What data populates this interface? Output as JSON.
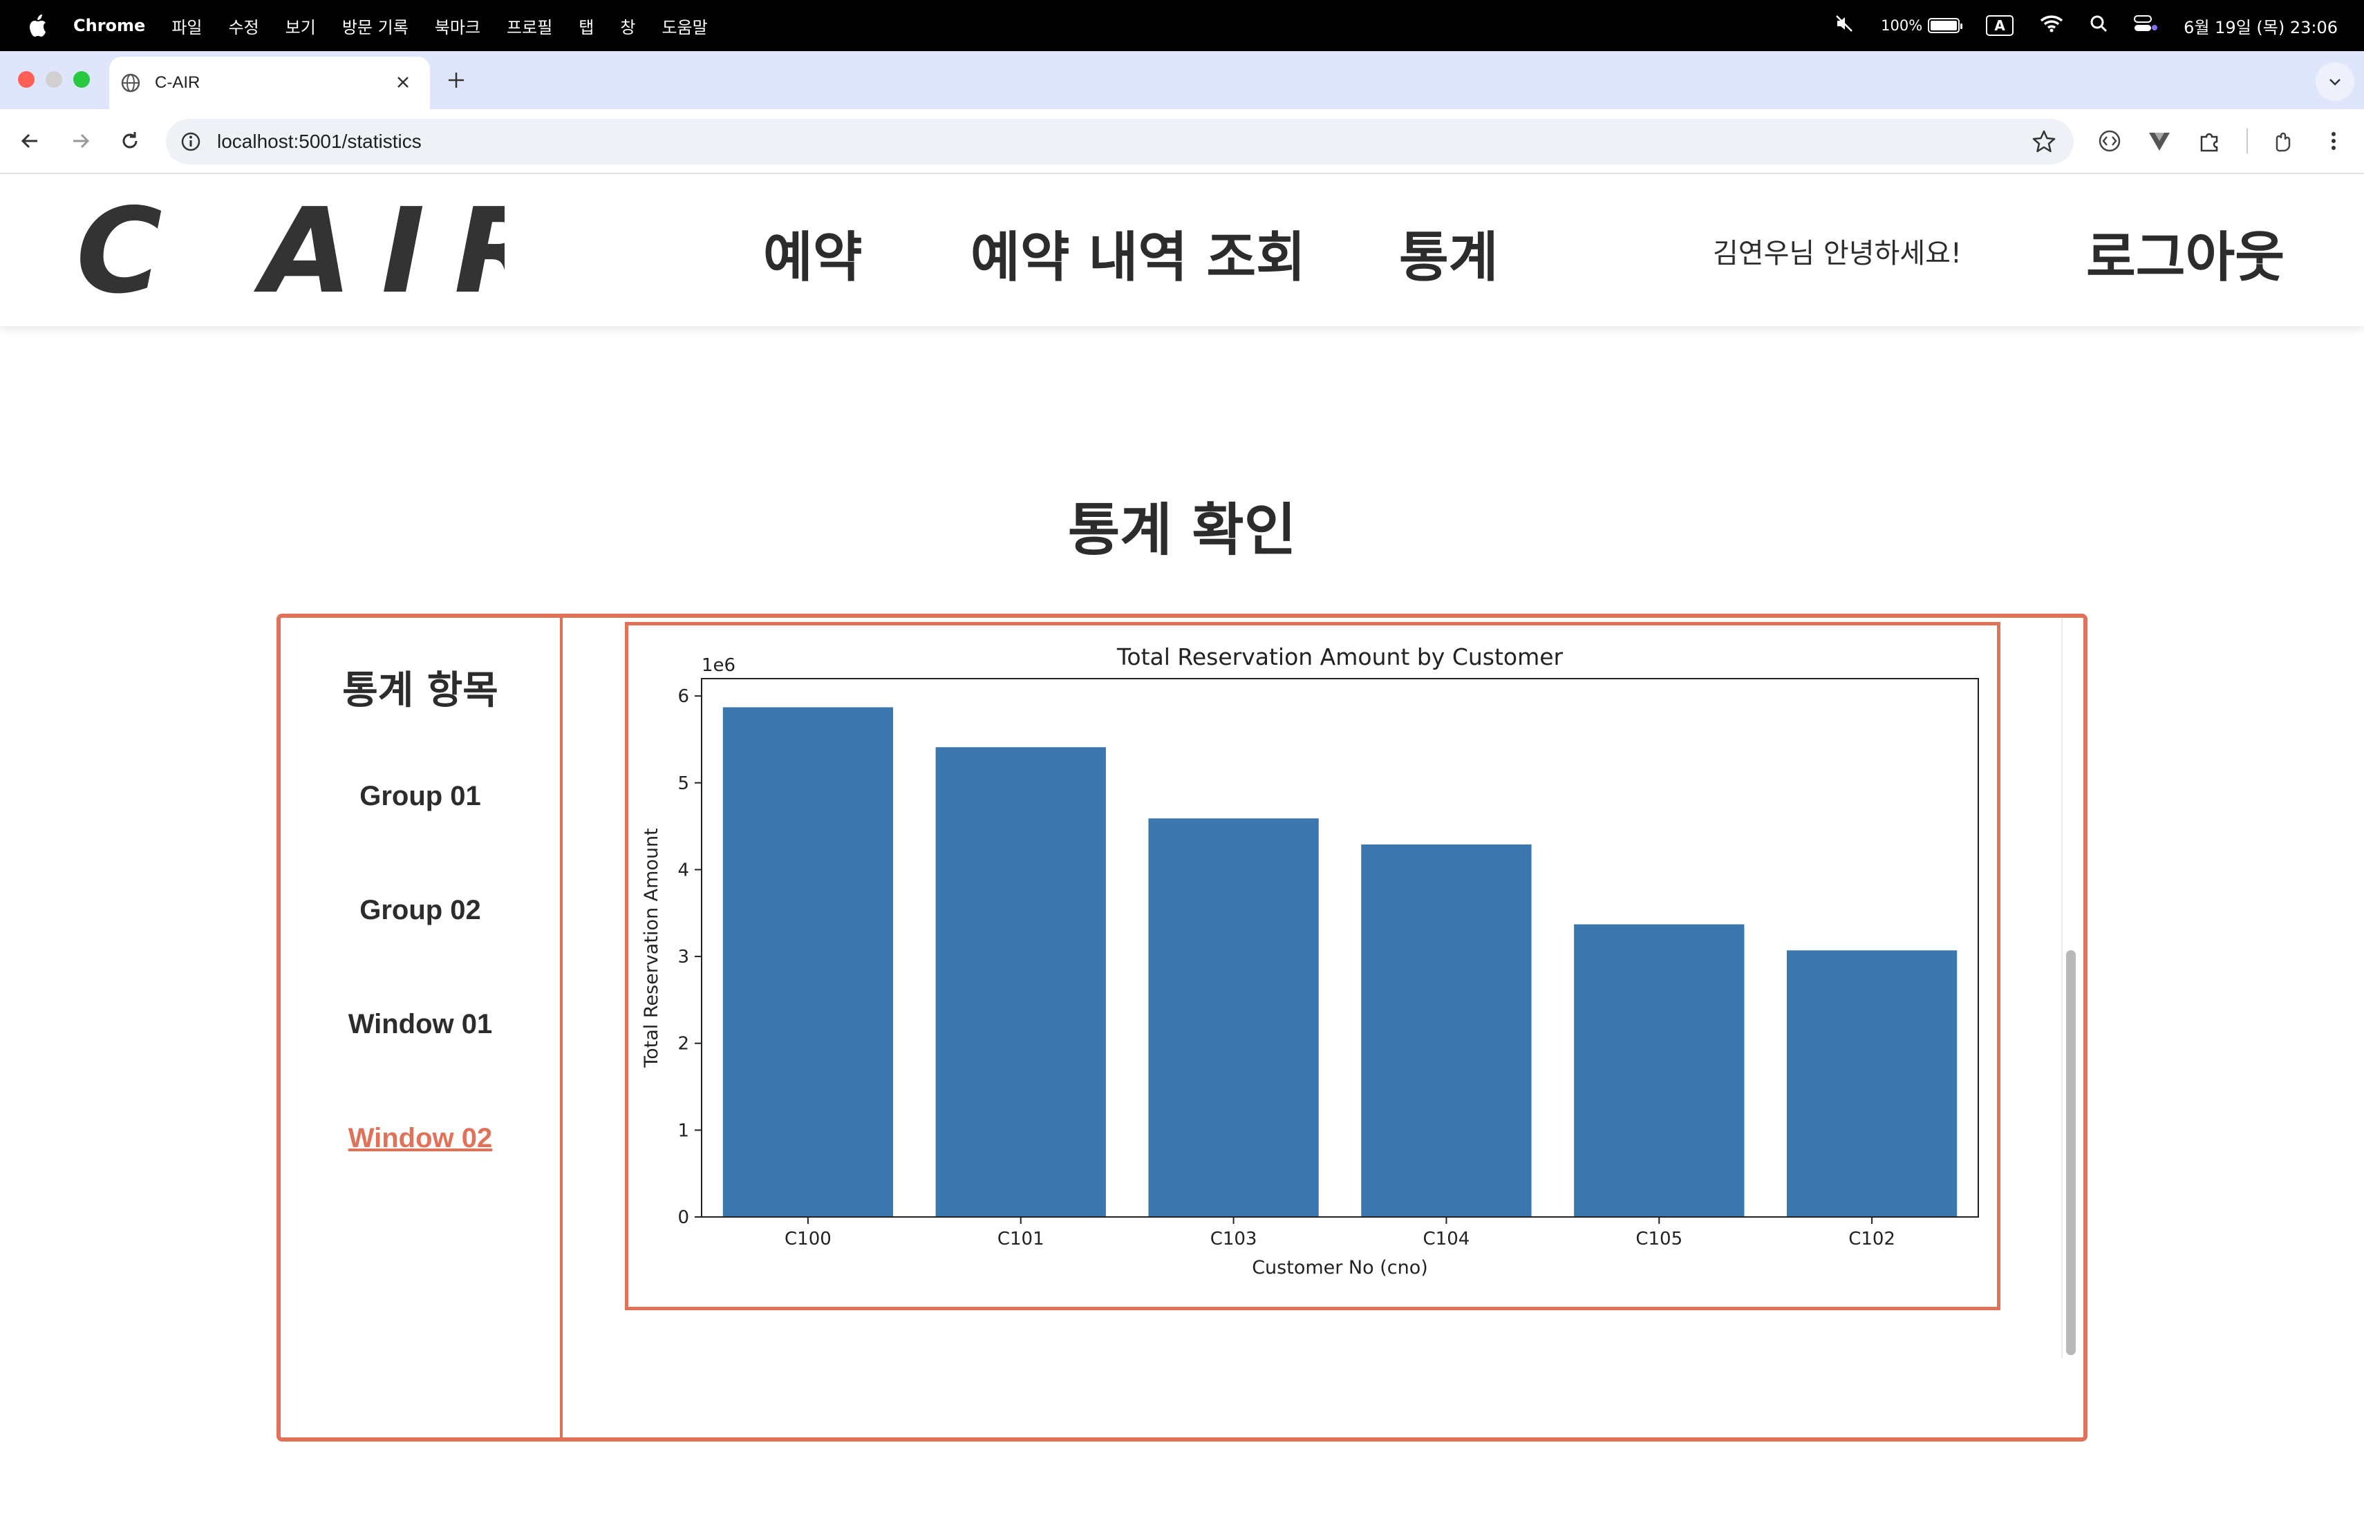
{
  "menubar": {
    "items": [
      "Chrome",
      "파일",
      "수정",
      "보기",
      "방문 기록",
      "북마크",
      "프로필",
      "탭",
      "창",
      "도움말"
    ],
    "battery": "100%",
    "battery_level_percent": 100,
    "input_source": "A",
    "datetime": "6월 19일 (목) 23:06"
  },
  "browser": {
    "tab_title": "C-AIR",
    "url": "localhost:5001/statistics"
  },
  "site": {
    "logo_text": "C AIR",
    "nav": [
      "예약",
      "예약 내역 조회",
      "통계"
    ],
    "greeting": "김연우님 안녕하세요!",
    "logout": "로그아웃"
  },
  "page": {
    "title": "통계 확인",
    "menu_heading": "통계 항목",
    "menu_items": [
      "Group 01",
      "Group 02",
      "Window 01",
      "Window 02"
    ],
    "active_item": "Window 02"
  },
  "colors": {
    "accent": "#e0725a",
    "bar": "#3b76af"
  },
  "chart_data": {
    "type": "bar",
    "title": "Total Reservation Amount by Customer",
    "xlabel": "Customer No (cno)",
    "ylabel": "Total Reservation Amount",
    "offset_label": "1e6",
    "categories": [
      "C100",
      "C101",
      "C103",
      "C104",
      "C105",
      "C102"
    ],
    "values": [
      5.87,
      5.41,
      4.59,
      4.29,
      3.37,
      3.07
    ],
    "ylim": [
      0,
      6.2
    ],
    "yticks": [
      "0",
      "1",
      "2",
      "3",
      "4",
      "5",
      "6"
    ],
    "grid": false,
    "legend": "none"
  }
}
